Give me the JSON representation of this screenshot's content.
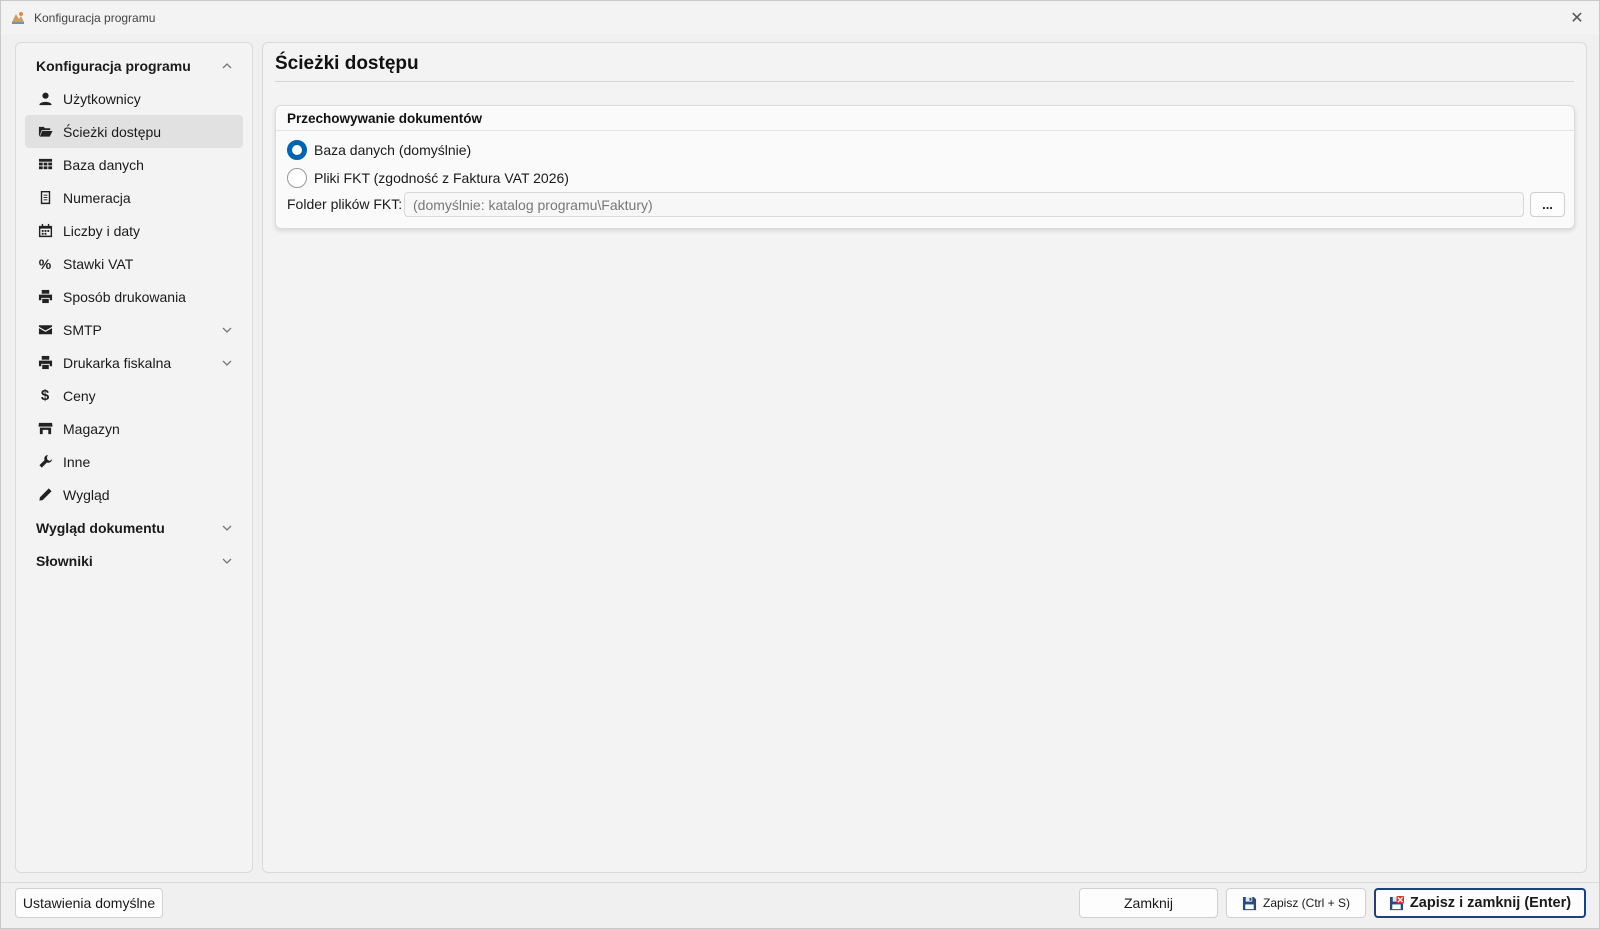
{
  "window": {
    "title": "Konfiguracja programu",
    "close_glyph": "✕",
    "app_icon": "app-logo-icon"
  },
  "sidebar": {
    "groups": [
      {
        "label": "Konfiguracja programu",
        "expanded": true
      },
      {
        "label": "Wygląd dokumentu",
        "expanded": false
      },
      {
        "label": "Słowniki",
        "expanded": false
      }
    ],
    "items": [
      {
        "label": "Użytkownicy",
        "icon": "user-icon"
      },
      {
        "label": "Ścieżki dostępu",
        "icon": "folder-open-icon",
        "selected": true
      },
      {
        "label": "Baza danych",
        "icon": "table-icon"
      },
      {
        "label": "Numeracja",
        "icon": "document-icon"
      },
      {
        "label": "Liczby i daty",
        "icon": "calendar-icon"
      },
      {
        "label": "Stawki VAT",
        "icon": "percent-icon",
        "glyph": "%"
      },
      {
        "label": "Sposób drukowania",
        "icon": "printer-icon"
      },
      {
        "label": "SMTP",
        "icon": "envelope-icon",
        "expandable": true
      },
      {
        "label": "Drukarka fiskalna",
        "icon": "printer-icon",
        "expandable": true
      },
      {
        "label": "Ceny",
        "icon": "dollar-icon",
        "glyph": "$"
      },
      {
        "label": "Magazyn",
        "icon": "store-icon"
      },
      {
        "label": "Inne",
        "icon": "wrench-icon"
      },
      {
        "label": "Wygląd",
        "icon": "pencil-icon"
      }
    ]
  },
  "main": {
    "title": "Ścieżki dostępu",
    "storage": {
      "title": "Przechowywanie dokumentów",
      "options": [
        {
          "label": "Baza danych (domyślnie)",
          "checked": true
        },
        {
          "label": "Pliki FKT (zgodność z Faktura VAT 2026)",
          "checked": false
        }
      ],
      "folder_label": "Folder plików FKT:",
      "folder_value": "",
      "folder_placeholder": "(domyślnie: katalog programu\\Faktury)",
      "browse_label": "..."
    }
  },
  "footer": {
    "defaults_label": "Ustawienia domyślne",
    "close_label": "Zamknij",
    "save_label": "Zapisz (Ctrl + S)",
    "save_close_label": "Zapisz i zamknij (Enter)"
  },
  "colors": {
    "accent": "#0063b1",
    "primary_button_border": "#1f3f78"
  }
}
